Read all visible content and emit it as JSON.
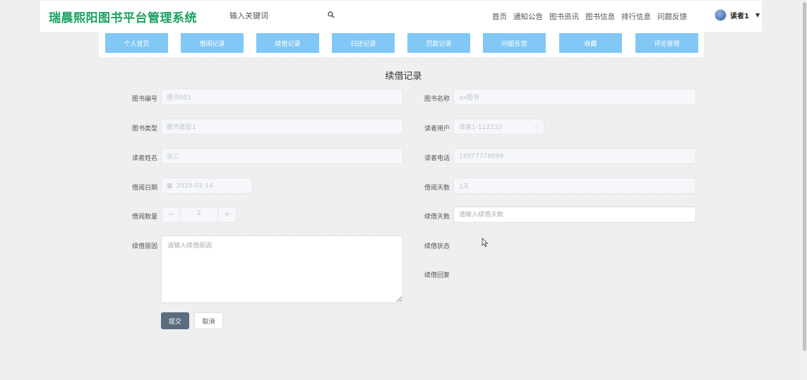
{
  "header": {
    "logo": "瑞晨熙阳图书平台管理系统",
    "search_placeholder": "输入关键词",
    "nav": [
      "首页",
      "通知公告",
      "图书资讯",
      "图书信息",
      "排行信息",
      "问题反馈"
    ],
    "user_name": "读者1"
  },
  "subnav": [
    "个人首页",
    "借阅记录",
    "续借记录",
    "归还记录",
    "罚款记录",
    "问题反馈",
    "收藏",
    "评论管理"
  ],
  "page_title": "续借记录",
  "form": {
    "book_no_label": "图书编号",
    "book_no_value": "图书001",
    "book_name_label": "图书名称",
    "book_name_value": "xx图书",
    "book_type_label": "图书类型",
    "book_type_value": "图书类型1",
    "reader_user_label": "读者用户",
    "reader_user_value": "读者1-112233",
    "reader_name_label": "读者姓名",
    "reader_name_value": "张三",
    "reader_phone_label": "读者电话",
    "reader_phone_value": "18977778899",
    "borrow_date_label": "借阅日期",
    "borrow_date_value": "2025-02-14",
    "borrow_days_label": "借阅天数",
    "borrow_days_value": "1天",
    "borrow_qty_label": "借阅数量",
    "borrow_qty_value": "2",
    "renew_days_label": "续借天数",
    "renew_days_placeholder": "请输入续借天数",
    "renew_reason_label": "续借原因",
    "renew_reason_placeholder": "请输入续借原因",
    "renew_status_label": "续借状态",
    "renew_reply_label": "续借回复",
    "submit_label": "提交",
    "cancel_label": "取消"
  },
  "colors": {
    "logo": "#1aa260",
    "subnav": "#81c8f6",
    "submit": "#5b6c7d"
  }
}
